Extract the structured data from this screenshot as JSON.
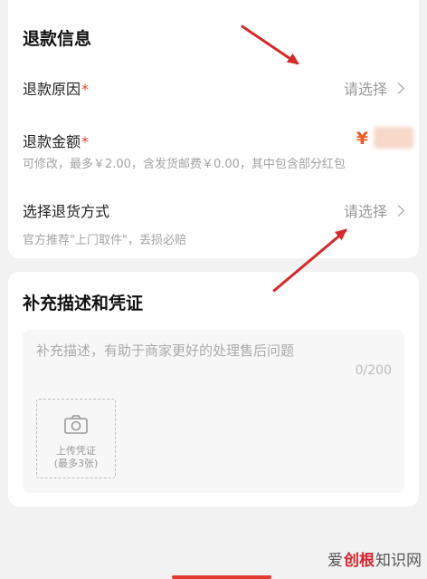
{
  "refund_info": {
    "title": "退款信息",
    "reason": {
      "label": "退款原因",
      "required_mark": "*",
      "value": "请选择"
    },
    "amount": {
      "label": "退款金额",
      "required_mark": "*",
      "currency_symbol": "¥",
      "hint": "可修改，最多￥2.00，含发货邮费￥0.00，其中包含部分红包"
    },
    "return_method": {
      "label": "选择退货方式",
      "value": "请选择",
      "hint": "官方推荐\"上门取件\"，丢损必赔"
    }
  },
  "evidence": {
    "title": "补充描述和凭证",
    "description_placeholder": "补充描述，有助于商家更好的处理售后问题",
    "char_count": "0/200",
    "upload": {
      "line1": "上传凭证",
      "line2": "(最多3张)",
      "icon": "camera-icon"
    }
  },
  "watermark": {
    "part1": "爱",
    "part2": "创根",
    "part3": "知识网"
  },
  "colors": {
    "accent": "#ef5a1e",
    "annotation_arrow": "#d62a2a",
    "required": "#e8442f"
  }
}
